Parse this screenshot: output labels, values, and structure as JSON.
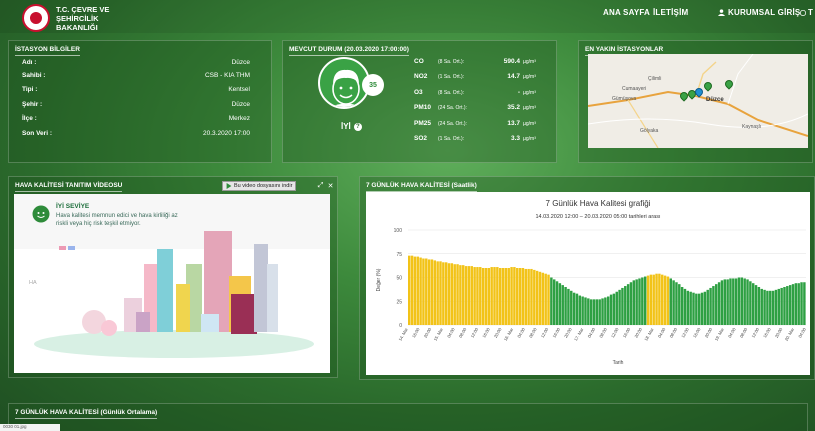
{
  "header": {
    "ministry_line1": "T.C. ÇEVRE VE",
    "ministry_line2": "ŞEHİRCİLİK BAKANLIĞI",
    "nav": {
      "home": "ANA SAYFA",
      "contact": "İLETİŞİM",
      "login": "KURUMSAL GİRİŞ",
      "cut": "T"
    }
  },
  "station": {
    "title": "İSTASYON BİLGİLER",
    "rows": [
      {
        "label": "Adı :",
        "value": "Düzce"
      },
      {
        "label": "Sahibi :",
        "value": "CSB - KIA THM"
      },
      {
        "label": "Tipi :",
        "value": "Kentsel"
      },
      {
        "label": "Şehir :",
        "value": "Düzce"
      },
      {
        "label": "İlçe :",
        "value": "Merkez"
      },
      {
        "label": "Son Veri :",
        "value": "20.3.2020 17:00"
      }
    ]
  },
  "current": {
    "title": "MEVCUT DURUM (20.03.2020 17:00:00)",
    "aqi_value": "35",
    "status": "İYİ",
    "help": "?",
    "pollutants": [
      {
        "name": "CO",
        "sub": "(8 Sa. Ort.):",
        "value": "590.4",
        "unit": "µg/m³"
      },
      {
        "name": "NO2",
        "sub": "(1 Sa. Ort.):",
        "value": "14.7",
        "unit": "µg/m³"
      },
      {
        "name": "O3",
        "sub": "(8 Sa. Ort.):",
        "value": "-",
        "unit": "µg/m³"
      },
      {
        "name": "PM10",
        "sub": "(24 Sa. Ort.):",
        "value": "35.2",
        "unit": "µg/m³"
      },
      {
        "name": "PM25",
        "sub": "(24 Sa. Ort.):",
        "value": "13.7",
        "unit": "µg/m³"
      },
      {
        "name": "SO2",
        "sub": "(1 Sa. Ort.):",
        "value": "3.3",
        "unit": "µg/m³"
      }
    ]
  },
  "nearby": {
    "title": "EN YAKIN İSTASYONLAR",
    "map_labels": [
      "Çilimli",
      "Cumaayeri",
      "Gümüşova",
      "Düzce",
      "Gölyaka",
      "Kaynaşlı"
    ]
  },
  "video": {
    "title": "HAVA KALİTESİ TANITIM VİDEOSU",
    "download": "Bu video dosyasını indir",
    "level": "İYİ SEVİYE",
    "description": "Hava kalitesi memnun edici ve hava kirliliği az riskli veya hiç risk teşkil etmiyor.",
    "corner_icon": "HA"
  },
  "hourly": {
    "title": "7 GÜNLÜK HAVA KALİTESİ (Saatlik)"
  },
  "daily": {
    "title": "7 GÜNLÜK HAVA KALİTESİ (Günlük Ortalama)"
  },
  "taskbar": {
    "file": "0030 01.jpg"
  },
  "chart_data": {
    "type": "bar",
    "title": "7 Günlük Hava Kalitesi grafiği",
    "subtitle": "14.03.2020 12:00 – 20.03.2020 05:00 tarihleri arası",
    "xlabel": "Tarih",
    "ylabel": "Değer (%)",
    "ylim": [
      0,
      100
    ],
    "yticks": [
      0,
      25,
      50,
      75,
      100
    ],
    "xticks": [
      "14. Mar",
      "16:00",
      "20:00",
      "15. Mar",
      "04:00",
      "08:00",
      "12:00",
      "16:00",
      "20:00",
      "16. Mar",
      "04:00",
      "08:00",
      "12:00",
      "16:00",
      "20:00",
      "17. Mar",
      "04:00",
      "08:00",
      "12:00",
      "16:00",
      "20:00",
      "18. Mar",
      "04:00",
      "08:00",
      "12:00",
      "16:00",
      "20:00",
      "19. Mar",
      "04:00",
      "08:00",
      "12:00",
      "16:00",
      "20:00",
      "20. Mar",
      "04:00"
    ],
    "colors": {
      "moderate": "#f2c318",
      "good": "#2ea043"
    },
    "segments": [
      {
        "color": "moderate",
        "values": [
          73,
          73,
          72,
          72,
          71,
          70,
          70,
          69,
          69,
          68,
          67,
          67,
          66,
          66,
          65,
          65,
          64,
          64,
          63,
          63,
          62,
          62,
          62,
          61,
          61,
          61,
          60,
          60,
          60,
          61,
          61,
          61,
          60,
          60,
          60,
          60,
          61,
          61,
          60,
          60,
          60,
          59,
          59,
          59,
          58,
          57,
          56,
          55,
          54,
          53
        ]
      },
      {
        "color": "good",
        "values": [
          50,
          48,
          46,
          44,
          42,
          40,
          38,
          36,
          34,
          33,
          31,
          30,
          29,
          28,
          27,
          27,
          27,
          27,
          28,
          29,
          30,
          32,
          33,
          35,
          37,
          39,
          41,
          43,
          45,
          47,
          48,
          49,
          50,
          51
        ]
      },
      {
        "color": "moderate",
        "values": [
          52,
          53,
          53,
          54,
          54,
          53,
          52,
          51
        ]
      },
      {
        "color": "good",
        "values": [
          49,
          47,
          45,
          43,
          40,
          38,
          36,
          35,
          34,
          33,
          33,
          34,
          35,
          37,
          39,
          41,
          43,
          45,
          47,
          48,
          48,
          49,
          49,
          49,
          50,
          50,
          49,
          48,
          46,
          44,
          42,
          40,
          38,
          37,
          36,
          36,
          36,
          37,
          38,
          39,
          40,
          41,
          42,
          43,
          44,
          44,
          45,
          45
        ]
      }
    ]
  }
}
